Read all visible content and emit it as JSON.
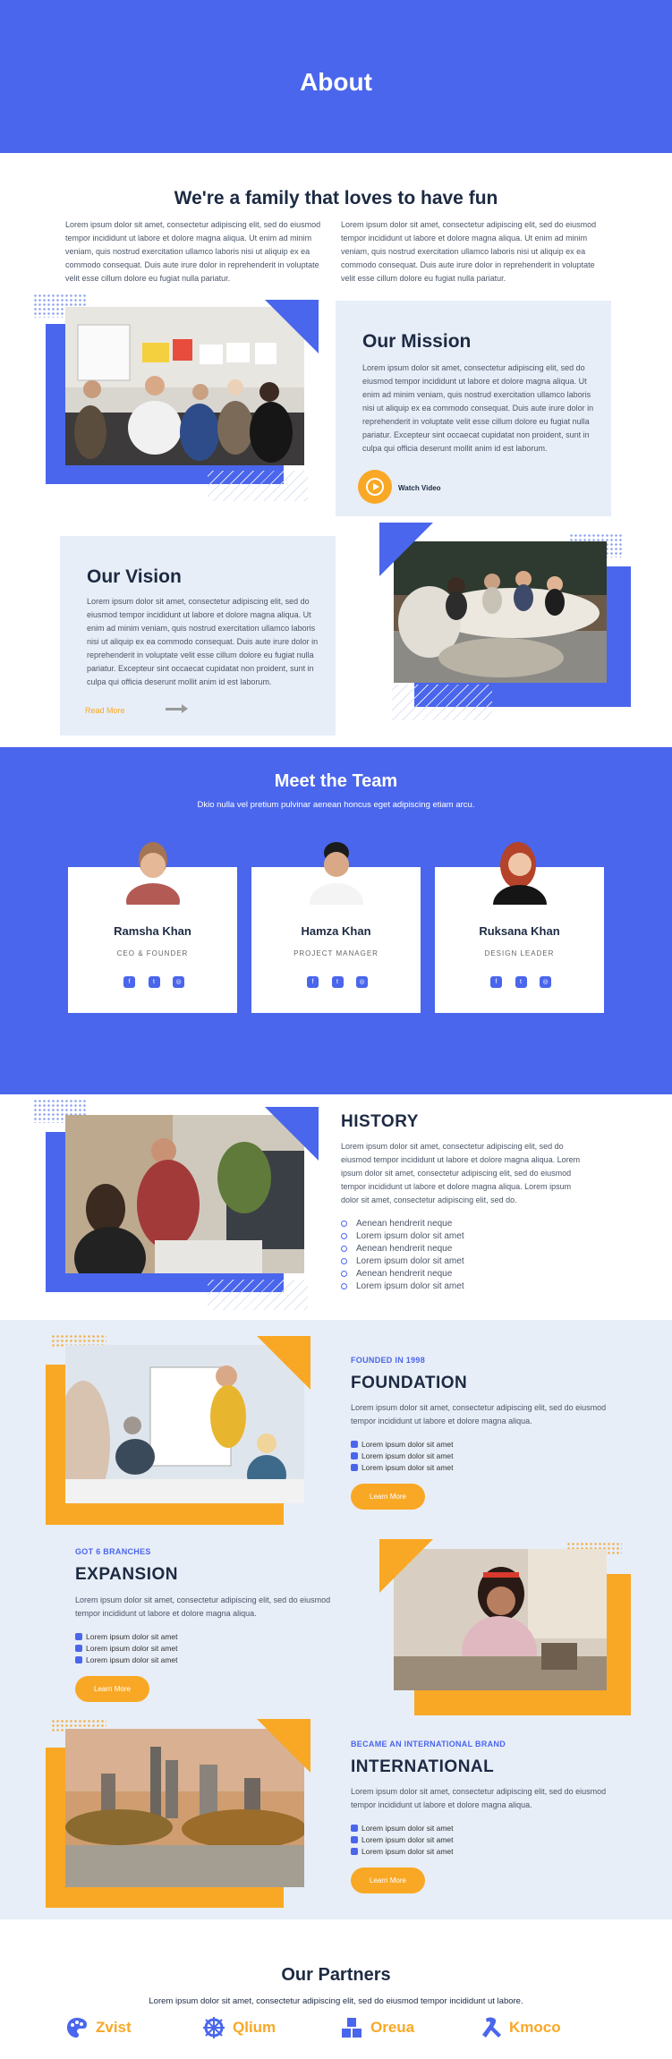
{
  "hero": {
    "title": "About"
  },
  "family": {
    "title": "We're a family that loves to have fun",
    "col1": "Lorem ipsum dolor sit amet, consectetur adipiscing elit, sed do eiusmod tempor incididunt ut labore et dolore magna aliqua. Ut enim ad minim veniam, quis nostrud exercitation ullamco laboris nisi ut aliquip ex ea commodo consequat. Duis aute irure dolor in reprehenderit in voluptate velit esse cillum dolore eu fugiat nulla pariatur.",
    "col2": "Lorem ipsum dolor sit amet, consectetur adipiscing elit, sed do eiusmod tempor incididunt ut labore et dolore magna aliqua. Ut enim ad minim veniam, quis nostrud exercitation ullamco laboris nisi ut aliquip ex ea commodo consequat. Duis aute irure dolor in reprehenderit in voluptate velit esse cillum dolore eu fugiat nulla pariatur."
  },
  "mission": {
    "title": "Our Mission",
    "text": "Lorem ipsum dolor sit amet, consectetur adipiscing elit, sed do eiusmod tempor incididunt ut labore et dolore magna aliqua. Ut enim ad minim veniam, quis nostrud exercitation ullamco laboris nisi ut aliquip ex ea commodo consequat. Duis aute irure dolor in reprehenderit in voluptate velit esse cillum dolore eu fugiat nulla pariatur. Excepteur sint occaecat cupidatat non proident, sunt in culpa qui officia deserunt mollit anim id est laborum.",
    "video_label": "Watch Video"
  },
  "vision": {
    "title": "Our Vision",
    "text": "Lorem ipsum dolor sit amet, consectetur adipiscing elit, sed do eiusmod tempor incididunt ut labore et dolore magna aliqua. Ut enim ad minim veniam, quis nostrud exercitation ullamco laboris nisi ut aliquip ex ea commodo consequat. Duis aute irure dolor in reprehenderit in voluptate velit esse cillum dolore eu fugiat nulla pariatur. Excepteur sint occaecat cupidatat non proident, sunt in culpa qui officia deserunt mollit anim id est laborum.",
    "read_more": "Read More"
  },
  "team": {
    "title": "Meet the Team",
    "subtitle": "Dkio nulla vel pretium pulvinar aenean honcus eget adipiscing etiam arcu.",
    "members": [
      {
        "name": "Ramsha Khan",
        "role": "CEO & FOUNDER"
      },
      {
        "name": "Hamza Khan",
        "role": "PROJECT MANAGER"
      },
      {
        "name": "Ruksana Khan",
        "role": "DESIGN LEADER"
      }
    ],
    "social_icons": [
      "facebook-icon",
      "twitter-icon",
      "instagram-icon"
    ]
  },
  "history": {
    "title": "HISTORY",
    "text": "Lorem ipsum dolor sit amet, consectetur adipiscing elit, sed do eiusmod tempor incididunt ut labore et dolore magna aliqua. Lorem ipsum dolor sit amet, consectetur adipiscing elit, sed do eiusmod tempor incididunt ut labore et dolore magna aliqua. Lorem ipsum dolor sit amet, consectetur adipiscing elit, sed do.",
    "items": [
      "Aenean hendrerit neque",
      "Lorem ipsum dolor sit amet",
      "Aenean hendrerit neque",
      "Lorem ipsum dolor sit amet",
      "Aenean hendrerit neque",
      "Lorem ipsum dolor sit amet"
    ]
  },
  "foundation": {
    "kicker": "FOUNDED IN 1998",
    "title": "FOUNDATION",
    "text": "Lorem ipsum dolor sit amet, consectetur adipiscing elit, sed do eiusmod tempor incididunt ut labore et dolore magna aliqua.",
    "items": [
      "Lorem ipsum dolor sit amet",
      "Lorem ipsum dolor sit amet",
      "Lorem ipsum dolor sit amet"
    ],
    "button": "Learn More"
  },
  "expansion": {
    "kicker": "GOT 6 BRANCHES",
    "title": "EXPANSION",
    "text": "Lorem ipsum dolor sit amet, consectetur adipiscing elit, sed do eiusmod tempor incididunt ut labore et dolore magna aliqua.",
    "items": [
      "Lorem ipsum dolor sit amet",
      "Lorem ipsum dolor sit amet",
      "Lorem ipsum dolor sit amet"
    ],
    "button": "Learn More"
  },
  "international": {
    "kicker": "BECAME AN INTERNATIONAL BRAND",
    "title": "INTERNATIONAL",
    "text": "Lorem ipsum dolor sit amet, consectetur adipiscing elit, sed do eiusmod tempor incididunt ut labore et dolore magna aliqua.",
    "items": [
      "Lorem ipsum dolor sit amet",
      "Lorem ipsum dolor sit amet",
      "Lorem ipsum dolor sit amet"
    ],
    "button": "Learn More"
  },
  "partners": {
    "title": "Our Partners",
    "subtitle": "Lorem ipsum dolor sit amet, consectetur adipiscing elit, sed do eiusmod tempor incididunt ut labore.",
    "items": [
      {
        "name": "Zvist",
        "icon": "palette-icon"
      },
      {
        "name": "Qlium",
        "icon": "wheel-icon"
      },
      {
        "name": "Oreua",
        "icon": "blocks-icon"
      },
      {
        "name": "Kmoco",
        "icon": "ribbon-icon"
      }
    ]
  },
  "colors": {
    "primary": "#4a66ec",
    "accent": "#f9a825",
    "light_bg": "#e8eef7",
    "heading": "#1d2a43"
  }
}
